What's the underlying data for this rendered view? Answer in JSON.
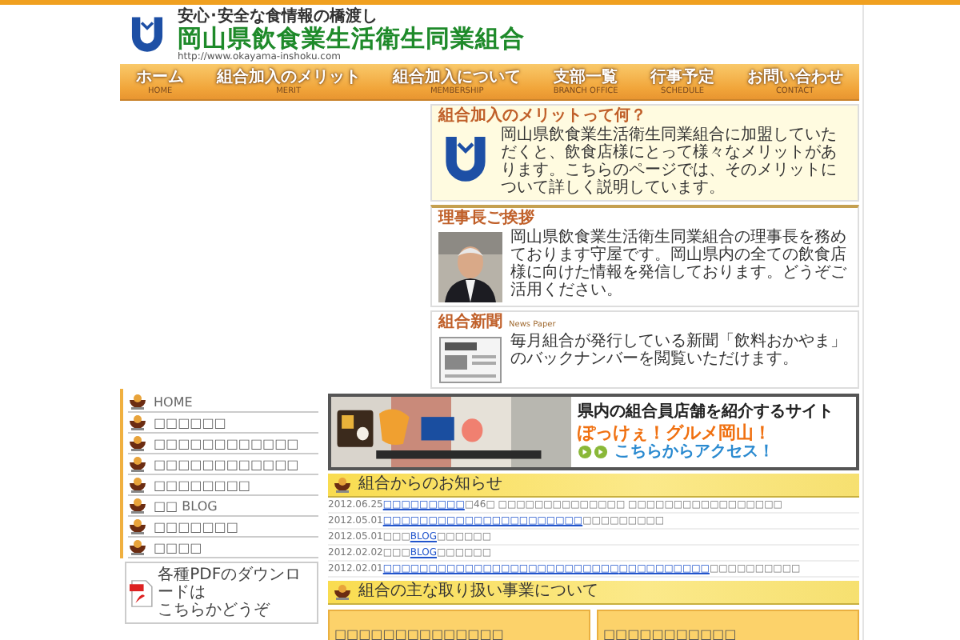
{
  "header": {
    "tagline": "安心･安全な食情報の橋渡し",
    "title": "岡山県飲食業生活衛生同業組合",
    "url": "http://www.okayama-inshoku.com"
  },
  "nav": [
    {
      "label": "ホーム",
      "sub": "HOME"
    },
    {
      "label": "組合加入のメリット",
      "sub": "MERIT"
    },
    {
      "label": "組合加入について",
      "sub": "MEMBERSHIP"
    },
    {
      "label": "支部一覧",
      "sub": "BRANCH OFFICE"
    },
    {
      "label": "行事予定",
      "sub": "SCHEDULE"
    },
    {
      "label": "お問い合わせ",
      "sub": "CONTACT"
    }
  ],
  "side_boxes": [
    {
      "kind": "logo",
      "title": "組合加入のメリットって何？",
      "text": "岡山県飲食業生活衛生同業組合に加盟していただくと、飲食店様にとって様々なメリットがあります。こちらのページでは、そのメリットについて詳しく説明しています。"
    },
    {
      "kind": "portrait",
      "title": "理事長ご挨拶",
      "text": "岡山県飲食業生活衛生同業組合の理事長を務めております守屋です。岡山県内の全ての飲食店様に向けた情報を発信しております。どうぞご活用ください。"
    },
    {
      "kind": "newspaper",
      "title": "組合新聞",
      "subtitle": "News Paper",
      "text": "毎月組合が発行している新聞「飲料おかやま」のバックナンバーを閲覧いただけます。"
    }
  ],
  "left_menu": [
    "HOME",
    "□□□□□□",
    "□□□□□□□□□□□□",
    "□□□□□□□□□□□□",
    "□□□□□□□□",
    "□□ BLOG",
    "□□□□□□□",
    "□□□□"
  ],
  "pdf_link": {
    "line1": "各種PDFのダウンロードは",
    "line2": "こちらかどうぞ"
  },
  "banner": {
    "heading": "県内の組合員店舗を紹介するサイト",
    "name": "ぽっけぇ！グルメ岡山！",
    "link": "こちらからアクセス！"
  },
  "news": {
    "title": "組合からのお知らせ",
    "items": [
      {
        "date": "2012.06.25",
        "parts": [
          {
            "text": "□□□□□□□□□",
            "link": true
          },
          {
            "text": "□46□ □□□□□□□□□□□□□□ □□□□□□□□□□□□□□□□□",
            "link": false
          }
        ]
      },
      {
        "date": "2012.05.01",
        "parts": [
          {
            "text": "□□□□□□□□□□□□□□□□□□□□□□",
            "link": true
          },
          {
            "text": " □□□□□□□□□",
            "link": false
          }
        ]
      },
      {
        "date": "2012.05.01",
        "parts": [
          {
            "text": "□□□",
            "link": false
          },
          {
            "text": "BLOG",
            "link": true
          },
          {
            "text": "□□□□□□",
            "link": false
          }
        ]
      },
      {
        "date": "2012.02.02",
        "parts": [
          {
            "text": "□□□",
            "link": false
          },
          {
            "text": "BLOG",
            "link": true
          },
          {
            "text": "□□□□□□",
            "link": false
          }
        ]
      },
      {
        "date": "2012.02.01",
        "parts": [
          {
            "text": "□□□□□□□□□□□□□□□□□□□□□□□□□□",
            "link": true
          },
          {
            "text": "□□□□□□□□□□",
            "link": true
          },
          {
            "text": "□□□□□□□□□□",
            "link": false
          }
        ]
      }
    ]
  },
  "business": {
    "title": "組合の主な取り扱い事業について",
    "boxes": [
      "□□□□□□□□□□□□□□",
      "□□□□□□□□□□□"
    ]
  }
}
